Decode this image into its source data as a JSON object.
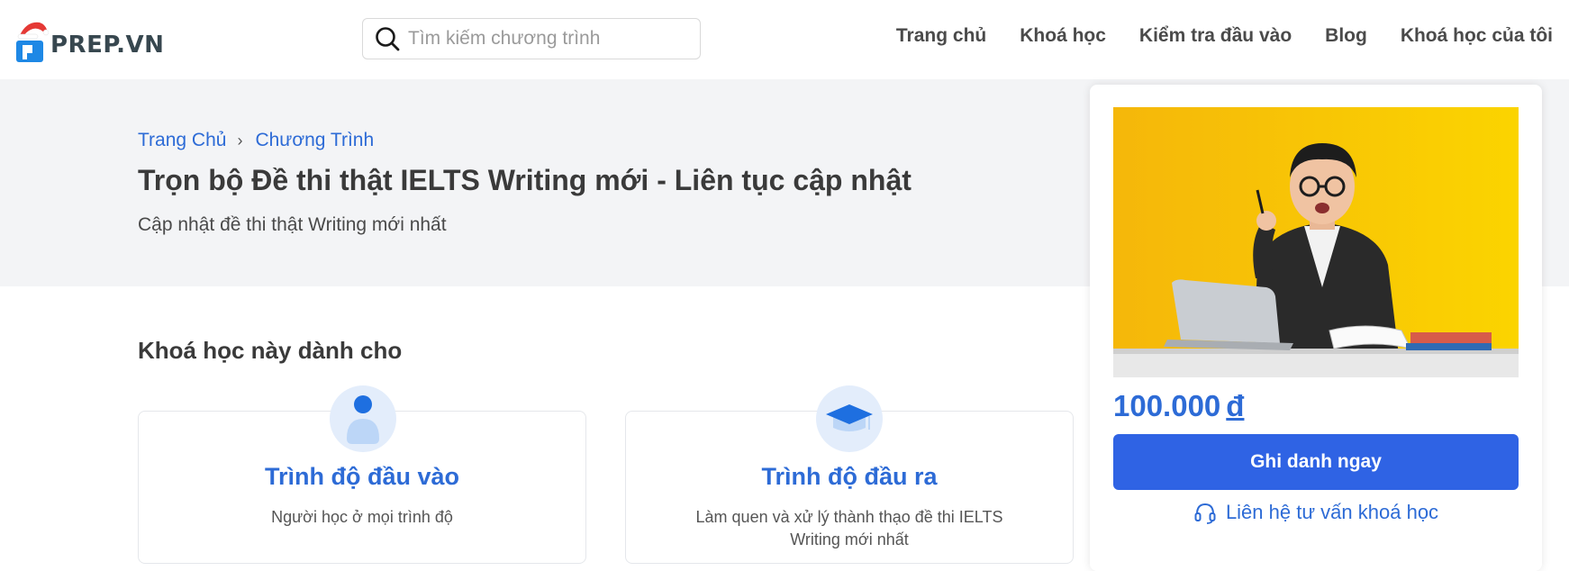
{
  "header": {
    "logo_text": "PREP.VN",
    "search_placeholder": "Tìm kiếm chương trình",
    "nav": [
      "Trang chủ",
      "Khoá học",
      "Kiểm tra đầu vào",
      "Blog",
      "Khoá học của tôi"
    ]
  },
  "hero": {
    "breadcrumb": [
      "Trang Chủ",
      "Chương Trình"
    ],
    "title": "Trọn bộ Đề thi thật IELTS Writing mới - Liên tục cập nhật",
    "subtitle": "Cập nhật đề thi thật Writing mới nhất"
  },
  "section": {
    "title": "Khoá học này dành cho",
    "cards": [
      {
        "icon": "user-icon",
        "title": "Trình độ đầu vào",
        "desc": "Người học ở mọi trình độ"
      },
      {
        "icon": "graduation-cap-icon",
        "title": "Trình độ đầu ra",
        "desc_line1": "Làm quen và xử lý thành thạo đề thi IELTS",
        "desc_line2": "Writing mới nhất"
      }
    ]
  },
  "panel": {
    "price": "100.000",
    "currency": "đ",
    "enroll_label": "Ghi danh ngay",
    "contact_label": "Liên hệ tư vấn khoá học"
  },
  "colors": {
    "primary": "#2f63e4",
    "link": "#2d6bd6",
    "hero_bg": "#f3f4f6",
    "photo_bg": "#f7c10a"
  }
}
